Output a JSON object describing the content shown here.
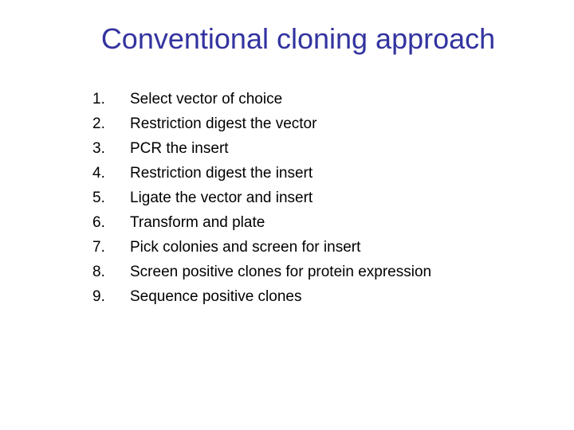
{
  "slide": {
    "title": "Conventional cloning approach",
    "title_color": "#3333a0",
    "steps": [
      {
        "num": "1.",
        "text": "Select vector of choice"
      },
      {
        "num": "2.",
        "text": "Restriction digest the vector"
      },
      {
        "num": "3.",
        "text": "PCR the insert"
      },
      {
        "num": "4.",
        "text": "Restriction digest the insert"
      },
      {
        "num": "5.",
        "text": "Ligate the vector and insert"
      },
      {
        "num": "6.",
        "text": "Transform and plate"
      },
      {
        "num": "7.",
        "text": "Pick colonies and screen for insert"
      },
      {
        "num": "8.",
        "text": "Screen positive clones for protein expression"
      },
      {
        "num": "9.",
        "text": "Sequence positive clones"
      }
    ]
  }
}
